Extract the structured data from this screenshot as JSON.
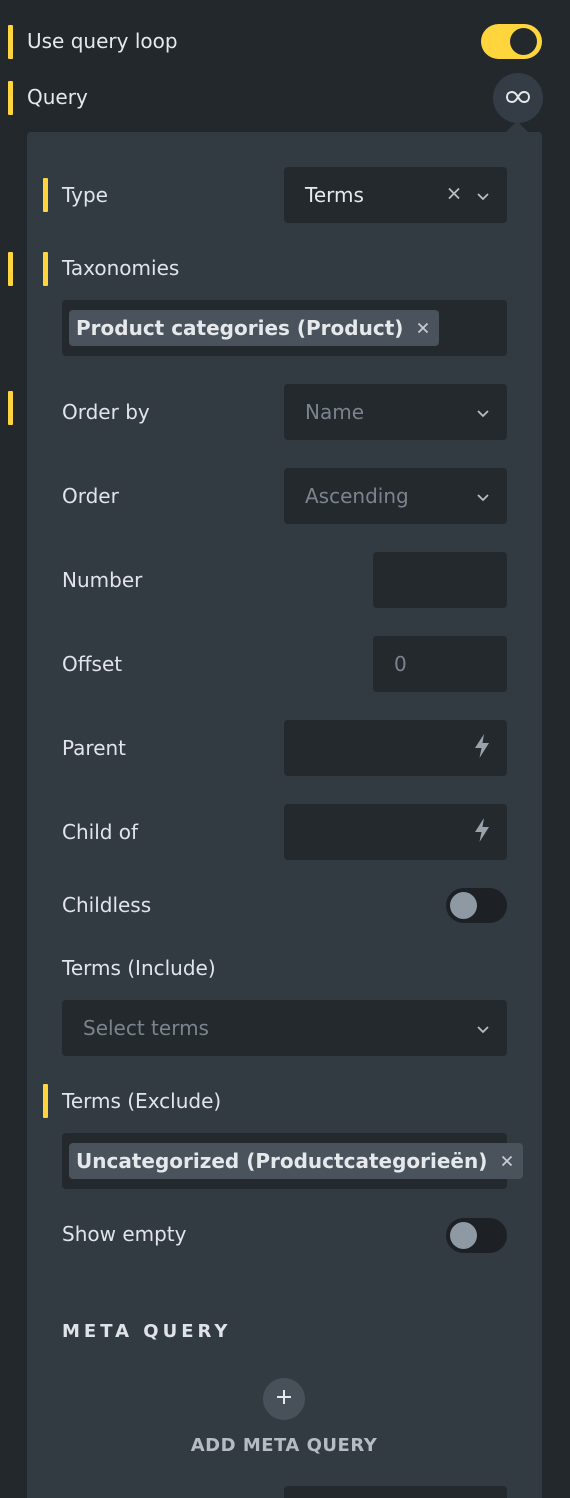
{
  "header": {
    "use_query_loop": {
      "label": "Use query loop",
      "enabled": true
    },
    "query": {
      "label": "Query",
      "icon": "infinity-icon"
    }
  },
  "query_panel": {
    "type": {
      "label": "Type",
      "value": "Terms"
    },
    "taxonomies": {
      "label": "Taxonomies",
      "tags": [
        "Product categories (Product)"
      ]
    },
    "order_by": {
      "label": "Order by",
      "placeholder": "Name"
    },
    "order": {
      "label": "Order",
      "placeholder": "Ascending"
    },
    "number": {
      "label": "Number",
      "value": ""
    },
    "offset": {
      "label": "Offset",
      "placeholder": "0"
    },
    "parent": {
      "label": "Parent",
      "icon": "bolt-icon"
    },
    "child_of": {
      "label": "Child of",
      "icon": "bolt-icon"
    },
    "childless": {
      "label": "Childless",
      "enabled": false
    },
    "terms_include": {
      "label": "Terms (Include)",
      "placeholder": "Select terms"
    },
    "terms_exclude": {
      "label": "Terms (Exclude)",
      "tags": [
        "Uncategorized (Productcategorieën)"
      ]
    },
    "show_empty": {
      "label": "Show empty",
      "enabled": false
    },
    "meta_query": {
      "title": "META QUERY",
      "add_label": "ADD META QUERY"
    }
  },
  "colors": {
    "accent": "#ffd53e",
    "background": "#23282d",
    "panel": "#323a42",
    "field": "#24292e"
  }
}
